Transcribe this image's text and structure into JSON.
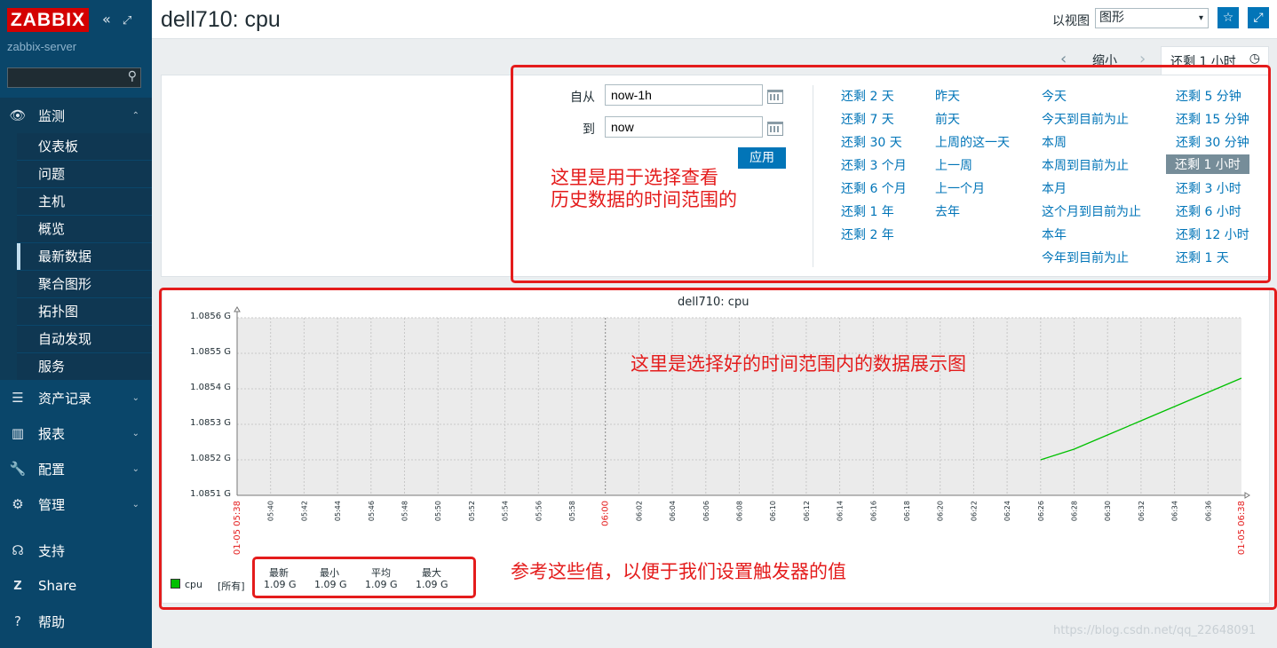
{
  "sidebar": {
    "logo": "ZABBIX",
    "collapse_icon": "double-chevron-left-icon",
    "kiosk_icon": "expand-icon",
    "server_name": "zabbix-server",
    "search_placeholder": "",
    "sections": [
      {
        "label": "监测",
        "icon": "eye-icon",
        "expanded": true
      },
      {
        "label": "资产记录",
        "icon": "list-icon"
      },
      {
        "label": "报表",
        "icon": "bar-chart-icon"
      },
      {
        "label": "配置",
        "icon": "wrench-icon"
      },
      {
        "label": "管理",
        "icon": "gear-icon"
      }
    ],
    "monitoring_items": [
      "仪表板",
      "问题",
      "主机",
      "概览",
      "最新数据",
      "聚合图形",
      "拓扑图",
      "自动发现",
      "服务"
    ],
    "selected_item": "最新数据",
    "footer": [
      {
        "label": "支持",
        "icon": "headset-icon"
      },
      {
        "label": "Share",
        "icon": "z-icon"
      },
      {
        "label": "帮助",
        "icon": "question-icon"
      }
    ]
  },
  "header": {
    "title": "dell710: cpu",
    "view_label": "以视图",
    "view_value": "图形",
    "favorite_icon": "star-icon",
    "fullscreen_icon": "fullscreen-icon"
  },
  "timebar": {
    "zoom_out": "缩小",
    "active_tab": "还剩 1 小时"
  },
  "filter": {
    "from_label": "自从",
    "from_value": "now-1h",
    "to_label": "到",
    "to_value": "now",
    "apply": "应用",
    "quick_col1": [
      "还剩 2 天",
      "还剩 7 天",
      "还剩 30 天",
      "还剩 3 个月",
      "还剩 6 个月",
      "还剩 1 年",
      "还剩 2 年"
    ],
    "quick_col2": [
      "昨天",
      "前天",
      "上周的这一天",
      "上一周",
      "上一个月",
      "去年"
    ],
    "quick_col3": [
      "今天",
      "今天到目前为止",
      "本周",
      "本周到目前为止",
      "本月",
      "这个月到目前为止",
      "本年",
      "今年到目前为止"
    ],
    "quick_col4": [
      "还剩 5 分钟",
      "还剩 15 分钟",
      "还剩 30 分钟",
      "还剩 1 小时",
      "还剩 3 小时",
      "还剩 6 小时",
      "还剩 12 小时",
      "还剩 1 天"
    ],
    "selected_quick": "还剩 1 小时"
  },
  "annotations": {
    "filter_note_line1": "这里是用于选择查看",
    "filter_note_line2": "历史数据的时间范围的",
    "graph_note": "这里是选择好的时间范围内的数据展示图",
    "legend_note": "参考这些值，以便于我们设置触发器的值",
    "color": "#e41c1c"
  },
  "chart_data": {
    "type": "line",
    "title": "dell710: cpu",
    "y_ticks": [
      "1.0856 G",
      "1.0855 G",
      "1.0854 G",
      "1.0853 G",
      "1.0852 G",
      "1.0851 G"
    ],
    "ylim": [
      1.0851,
      1.0856
    ],
    "x_ticks": [
      "05:40",
      "05:42",
      "05:44",
      "05:46",
      "05:48",
      "05:50",
      "05:52",
      "05:54",
      "05:56",
      "05:58",
      "06:00",
      "06:02",
      "06:04",
      "06:06",
      "06:08",
      "06:10",
      "06:12",
      "06:14",
      "06:16",
      "06:18",
      "06:20",
      "06:22",
      "06:24",
      "06:26",
      "06:28",
      "06:30",
      "06:32",
      "06:34",
      "06:36"
    ],
    "x_start_label": "01-05 05:38",
    "x_end_label": "01-05 06:38",
    "highlight_tick": "06:00",
    "series": [
      {
        "name": "cpu",
        "color": "#00c000",
        "x_minutes": [
          48,
          50,
          52,
          54,
          56,
          58,
          60
        ],
        "values": [
          1.0852,
          1.08523,
          1.08527,
          1.08531,
          1.08535,
          1.08539,
          1.08543
        ]
      }
    ],
    "grid": true
  },
  "legend": {
    "name": "cpu",
    "scope": "[所有]",
    "headers": [
      "最新",
      "最小",
      "平均",
      "最大"
    ],
    "values": [
      "1.09 G",
      "1.09 G",
      "1.09 G",
      "1.09 G"
    ]
  },
  "watermark": "https://blog.csdn.net/qq_22648091"
}
